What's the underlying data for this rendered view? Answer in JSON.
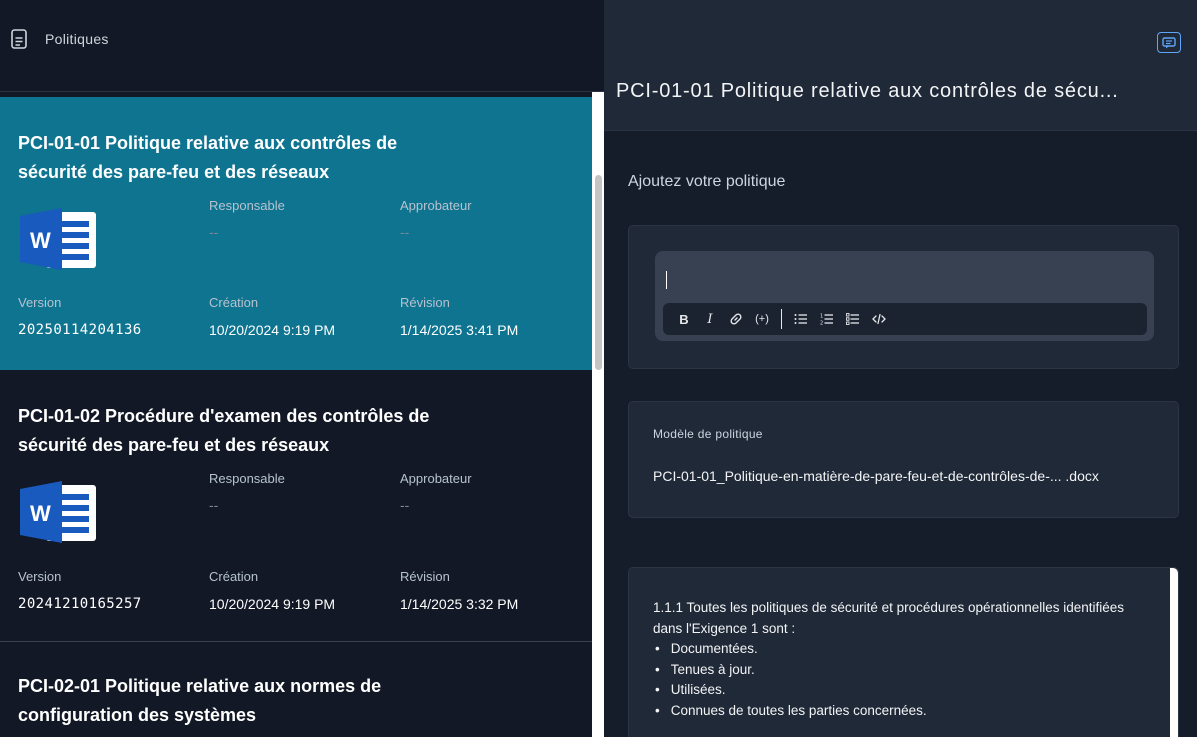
{
  "left": {
    "header_title": "Politiques",
    "cards": [
      {
        "title": "PCI-01-01 Politique relative aux contrôles de sécurité des pare-feu et des réseaux",
        "responsable_label": "Responsable",
        "responsable_value": "--",
        "approbateur_label": "Approbateur",
        "approbateur_value": "--",
        "version_label": "Version",
        "version_value": "20250114204136",
        "creation_label": "Création",
        "creation_value": "10/20/2024 9:19 PM",
        "revision_label": "Révision",
        "revision_value": "1/14/2025 3:41 PM"
      },
      {
        "title": "PCI-01-02 Procédure d'examen des contrôles de sécurité des pare-feu et des réseaux",
        "responsable_label": "Responsable",
        "responsable_value": "--",
        "approbateur_label": "Approbateur",
        "approbateur_value": "--",
        "version_label": "Version",
        "version_value": "20241210165257",
        "creation_label": "Création",
        "creation_value": "10/20/2024 9:19 PM",
        "revision_label": "Révision",
        "revision_value": "1/14/2025 3:32 PM"
      },
      {
        "title": "PCI-02-01 Politique relative aux normes de configuration des systèmes"
      }
    ]
  },
  "right": {
    "title": "PCI-01-01 Politique relative aux contrôles de sécu...",
    "subtitle": "Ajoutez votre politique",
    "toolbar": [
      "B",
      "I",
      "link",
      "(+)",
      "|",
      "bullet-list",
      "ordered-list",
      "task-list",
      "code"
    ],
    "template_label": "Modèle de politique",
    "template_file": "PCI-01-01_Politique-en-matière-de-pare-feu-et-de-contrôles-de-...  .docx",
    "content_intro": "1.1.1 Toutes les politiques de sécurité et procédures opérationnelles identifiées dans l'Exigence 1 sont :",
    "content_items": [
      "Documentées.",
      "Tenues à jour.",
      "Utilisées.",
      "Connues de toutes les parties concernées."
    ]
  },
  "colors": {
    "selected_card": "#0e7490",
    "accent": "#60a5fa",
    "word_blue": "#185abd"
  }
}
